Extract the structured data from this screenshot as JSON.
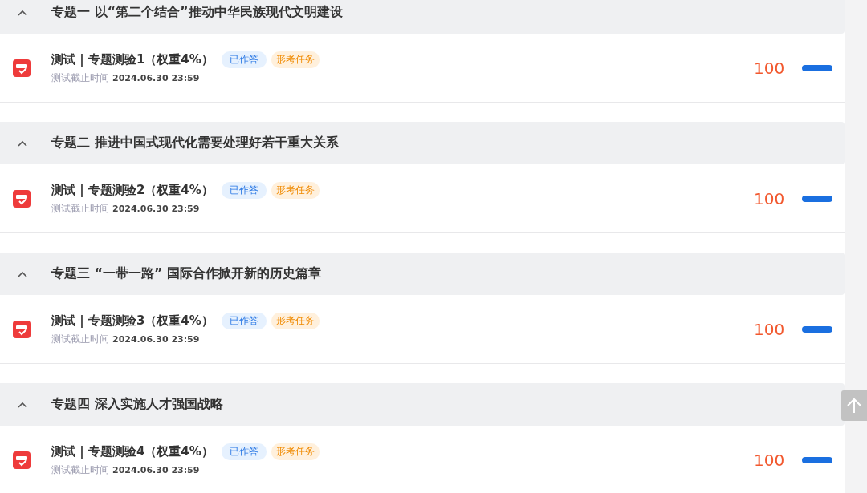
{
  "sections": [
    {
      "title": "专题一 以“第二个结合”推动中华民族现代文明建设",
      "expanded": true,
      "items": [
        {
          "title": "测试 | 专题测验1（权重4%）",
          "tags": [
            {
              "label": "已作答",
              "kind": "status"
            },
            {
              "label": "形考任务",
              "kind": "type"
            }
          ],
          "deadline_label": "测试截止时间",
          "deadline": "2024.06.30 23:59",
          "score": "100"
        }
      ]
    },
    {
      "title": "专题二 推进中国式现代化需要处理好若干重大关系",
      "expanded": true,
      "items": [
        {
          "title": "测试 | 专题测验2（权重4%）",
          "tags": [
            {
              "label": "已作答",
              "kind": "status"
            },
            {
              "label": "形考任务",
              "kind": "type"
            }
          ],
          "deadline_label": "测试截止时间",
          "deadline": "2024.06.30 23:59",
          "score": "100"
        }
      ]
    },
    {
      "title": "专题三 “一带一路” 国际合作掀开新的历史篇章",
      "expanded": true,
      "items": [
        {
          "title": "测试 | 专题测验3（权重4%）",
          "tags": [
            {
              "label": "已作答",
              "kind": "status"
            },
            {
              "label": "形考任务",
              "kind": "type"
            }
          ],
          "deadline_label": "测试截止时间",
          "deadline": "2024.06.30 23:59",
          "score": "100"
        }
      ]
    },
    {
      "title": "专题四 深入实施人才强国战略",
      "expanded": true,
      "items": [
        {
          "title": "测试 | 专题测验4（权重4%）",
          "tags": [
            {
              "label": "已作答",
              "kind": "status"
            },
            {
              "label": "形考任务",
              "kind": "type"
            }
          ],
          "deadline_label": "测试截止时间",
          "deadline": "2024.06.30 23:59",
          "score": "100"
        }
      ]
    }
  ]
}
